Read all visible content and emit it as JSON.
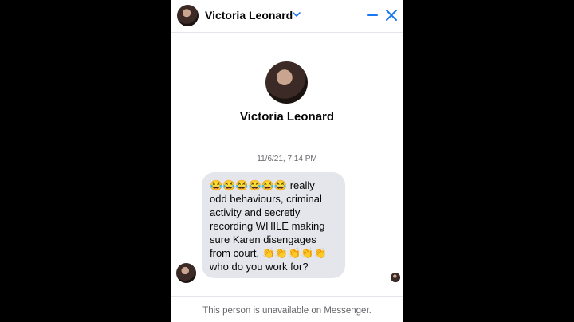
{
  "header": {
    "contact_name": "Victoria Leonard",
    "chevron_icon": "chevron-down-icon",
    "minimize_icon": "minimize-icon",
    "close_icon": "close-icon",
    "accent_color": "#1877f2"
  },
  "profile": {
    "name": "Victoria Leonard"
  },
  "conversation": {
    "timestamp": "11/6/21, 7:14 PM",
    "messages": [
      {
        "sender": "Victoria Leonard",
        "text": "😂😂😂😂😂😂 really\nodd behaviours, criminal\nactivity and secretly\nrecording WHILE making\nsure Karen disengages\nfrom court, 👏👏👏👏👏\nwho do you work for?"
      }
    ]
  },
  "footer": {
    "status_text": "This person is unavailable on Messenger."
  }
}
